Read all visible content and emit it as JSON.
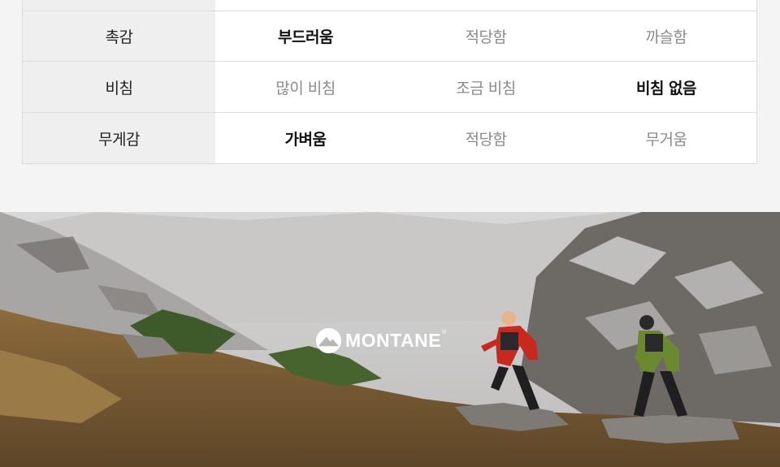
{
  "comparison": {
    "rows": [
      {
        "label": "촉감",
        "options": [
          "부드러움",
          "적당함",
          "까슬함"
        ],
        "selected": 0
      },
      {
        "label": "비침",
        "options": [
          "많이 비침",
          "조금 비침",
          "비침 없음"
        ],
        "selected": 2
      },
      {
        "label": "무게감",
        "options": [
          "가벼움",
          "적당함",
          "무거움"
        ],
        "selected": 0
      }
    ]
  },
  "hero": {
    "brand": "MONTANE",
    "brand_mark": "®",
    "accent_runner_1": "#c8291f",
    "accent_runner_2": "#5a7a2a"
  }
}
